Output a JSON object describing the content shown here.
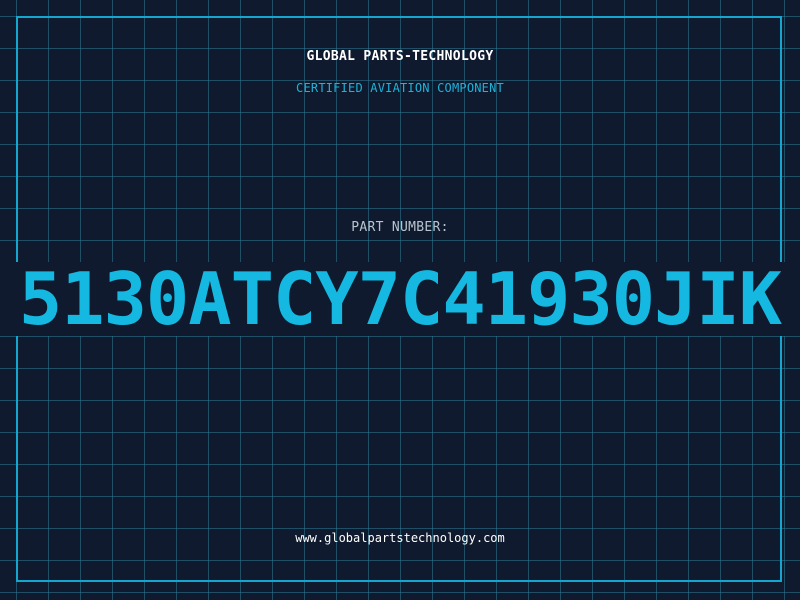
{
  "brand": {
    "title": "GLOBAL PARTS-TECHNOLOGY",
    "subtitle": "CERTIFIED AVIATION COMPONENT"
  },
  "part": {
    "label": "PART NUMBER:",
    "number": "5130ATCY7C41930JIK"
  },
  "footer": {
    "website": "www.globalpartstechnology.com"
  },
  "colors": {
    "background": "#101a2e",
    "grid": "#2c7a96",
    "accent": "#14b8e0",
    "frame": "#14a6cf",
    "label": "#b9c4d0",
    "text": "#ffffff"
  }
}
